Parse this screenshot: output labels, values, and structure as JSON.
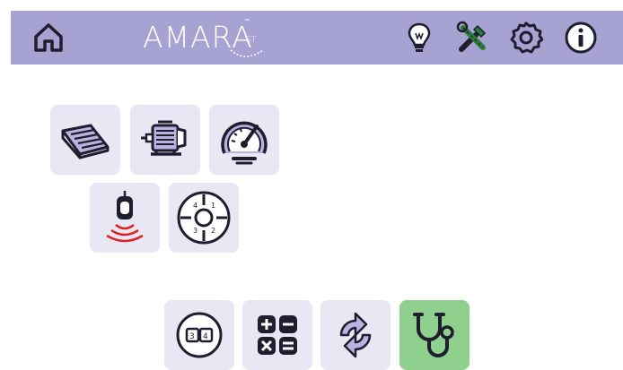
{
  "header": {
    "brand_word": "AMARA",
    "brand_tm": "™",
    "brand_suffix": "ST",
    "icons": [
      "home-icon",
      "lightbulb-icon",
      "tools-icon",
      "gear-icon",
      "info-icon"
    ]
  },
  "colors": {
    "header_bg": "#a6a2d2",
    "tile_bg": "#e8e8f4",
    "tile_active_bg": "#8fd08f",
    "icon_dark": "#1e1e2e",
    "icon_purple": "#b8b3e0",
    "signal_red": "#e02020"
  },
  "tiles": [
    {
      "icon": "keypad-icon"
    },
    {
      "icon": "motor-icon"
    },
    {
      "icon": "speedometer-icon"
    },
    {
      "icon": "remote-sensor-icon"
    },
    {
      "icon": "dial-selector-icon"
    },
    {
      "icon": "counter-display-icon"
    },
    {
      "icon": "calculator-icon"
    },
    {
      "icon": "refresh-cycle-icon"
    },
    {
      "icon": "stethoscope-icon",
      "active": true
    }
  ]
}
